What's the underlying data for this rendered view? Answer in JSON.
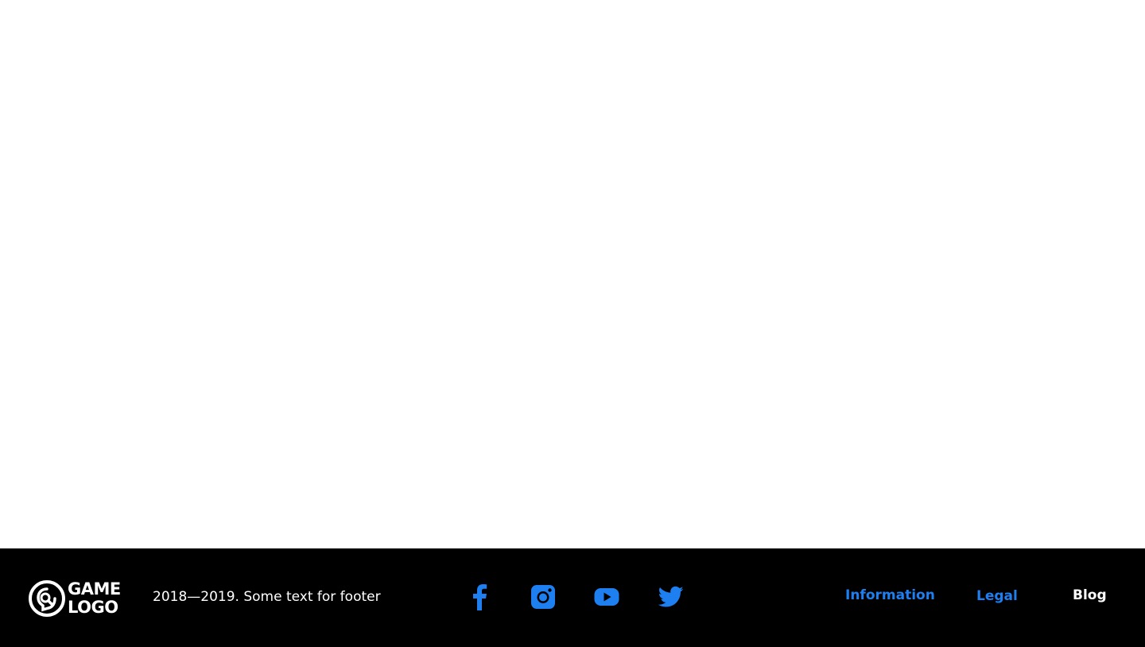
{
  "colors": {
    "footer_background": "#000000",
    "page_background": "#ffffff",
    "accent_blue": "#1e7ff0",
    "text_white": "#ffffff"
  },
  "footer": {
    "logo": {
      "line1": "GAME",
      "line2": "LOGO"
    },
    "copyright": "2018—2019. Some text for footer",
    "social": [
      {
        "icon": "facebook-icon"
      },
      {
        "icon": "instagram-icon"
      },
      {
        "icon": "youtube-icon"
      },
      {
        "icon": "twitter-icon"
      }
    ],
    "nav": {
      "information": "Information",
      "legal": "Legal",
      "blog": "Blog"
    }
  }
}
